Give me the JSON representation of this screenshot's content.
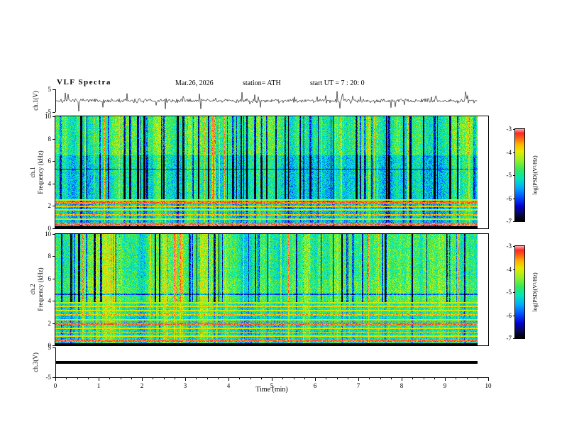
{
  "header": {
    "title": "VLF Spectra",
    "date": "Mar.26, 2026",
    "station": "station= ATH",
    "start_ut": "start UT =  7 : 20: 0"
  },
  "axes": {
    "x": {
      "label": "Time (min)",
      "min": 0,
      "max": 10,
      "ticks": [
        "0",
        "1",
        "2",
        "3",
        "4",
        "5",
        "6",
        "7",
        "8",
        "9",
        "10"
      ]
    },
    "ch1_wave": {
      "label": "ch.1(V)",
      "min": -5,
      "max": 5,
      "ticks": [
        "5",
        "-5"
      ]
    },
    "ch1_spec": {
      "label_line1": "ch.1",
      "label_line2": "Frequency (kHz)",
      "min": 0,
      "max": 10,
      "ticks": [
        "10",
        "8",
        "6",
        "4",
        "2",
        "0"
      ]
    },
    "ch2_spec": {
      "label_line1": "ch.2",
      "label_line2": "Frequency (kHz)",
      "min": 0,
      "max": 10,
      "ticks": [
        "10",
        "8",
        "6",
        "4",
        "2",
        "0"
      ]
    },
    "ch3_wave": {
      "label": "ch.3(V)",
      "min": -5,
      "max": 5,
      "ticks": [
        "5",
        "-5"
      ]
    }
  },
  "colorbar": {
    "label": "log(PSD)(V²/Hz)",
    "max": -3,
    "min": -7,
    "ticks": [
      "-3",
      "-4",
      "-5",
      "-6",
      "-7"
    ]
  },
  "chart_data": [
    {
      "type": "line",
      "name": "ch.1 voltage waveform",
      "ylabel": "ch.1(V)",
      "ylim": [
        -5,
        5
      ],
      "xlabel": "Time (min)",
      "xlim": [
        0,
        10
      ],
      "data_extent_min": [
        0,
        9.75
      ],
      "summary": "Zero-mean broadband noisy trace, background amplitude about ±1 V with dense impulsive spikes reaching roughly ±4 V throughout the 0–9.75 min record; drawn in black on white, no grid."
    },
    {
      "type": "heatmap",
      "name": "ch.1 spectrogram",
      "ylabel": "ch.1 Frequency (kHz)",
      "ylim": [
        0,
        10
      ],
      "xlabel": "Time (min)",
      "xlim": [
        0,
        10
      ],
      "data_extent_min": [
        0,
        9.75
      ],
      "zlabel": "log(PSD)(V²/Hz)",
      "zlim": [
        -7,
        -3
      ],
      "colormap": "jet-like (black floor at -7, blue→cyan→green→yellow→red/pink at -3)",
      "features": [
        "green/cyan background near log(PSD) ≈ -5",
        "intermittent vertical dark-blue dropout streaks, densest between ~2.5 and 6.5 kHz",
        "sporadic yellow/orange/red high-power vertical bursts over the whole band",
        "bright horizontal harmonic lines below ~2.5 kHz near 0.4, 0.8, 1.2, 1.6, 2.0 and 2.3 kHz (strongest near 0.4 and 2.3 kHz)",
        "black band at the very bottom near 0 kHz",
        "thin dark horizontal artifact line near 5.3 kHz",
        "white (no data) strip from ~9.75 to 10 min"
      ]
    },
    {
      "type": "heatmap",
      "name": "ch.2 spectrogram",
      "ylabel": "ch.2 Frequency (kHz)",
      "ylim": [
        0,
        10
      ],
      "xlabel": "Time (min)",
      "xlim": [
        0,
        10
      ],
      "data_extent_min": [
        0,
        9.75
      ],
      "zlabel": "log(PSD)(V²/Hz)",
      "zlim": [
        -7,
        -3
      ],
      "colormap": "jet-like (black floor at -7, blue→cyan→green→yellow→red/pink at -3)",
      "features": [
        "green background near log(PSD) ≈ -4.8, slightly brighter band between ~4 and 6 kHz",
        "vertical dark-blue dropout streaks mostly above ~4 kHz",
        "many bright horizontal harmonic lines below ~3.9 kHz near 0.4, 0.8, 1.15, 1.5, 1.9, 2.3, 2.7, 3.1, 3.5 and 3.8 kHz (strongest near 0.4 and 1.9 kHz)",
        "black band at the very bottom near 0 kHz",
        "thin dark horizontal artifact line near 4.6 kHz",
        "white (no data) strip from ~9.75 to 10 min"
      ]
    },
    {
      "type": "line",
      "name": "ch.3 voltage waveform",
      "ylabel": "ch.3(V)",
      "ylim": [
        -5,
        5
      ],
      "xlabel": "Time (min)",
      "xlim": [
        0,
        10
      ],
      "data_extent_min": [
        0,
        9.75
      ],
      "summary": "Flat constant trace at 0 V drawn as a thick black line (no signal on channel 3)."
    }
  ]
}
